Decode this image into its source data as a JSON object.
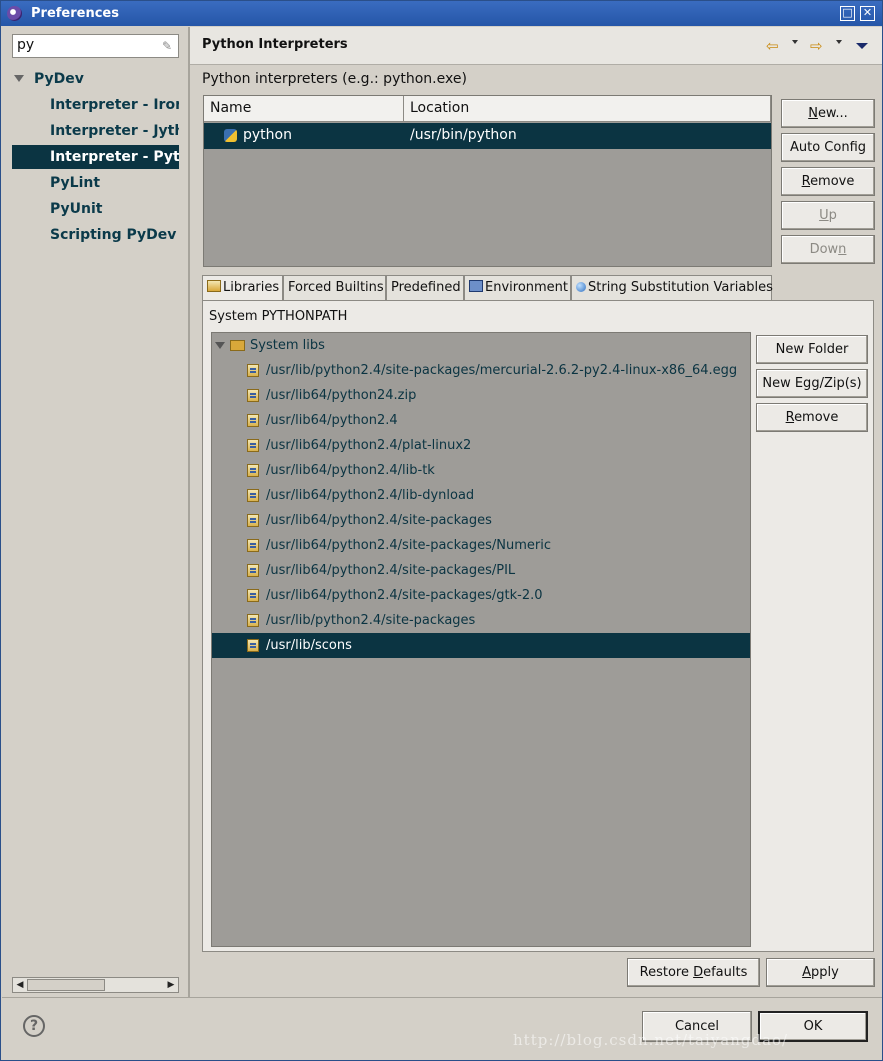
{
  "window": {
    "title": "Preferences"
  },
  "left": {
    "filter_value": "py",
    "tree": [
      {
        "label": "PyDev",
        "level": 0,
        "expanded": true,
        "selected": false
      },
      {
        "label": "Interpreter - IronPython",
        "level": 1,
        "selected": false
      },
      {
        "label": "Interpreter - Jython",
        "level": 1,
        "selected": false
      },
      {
        "label": "Interpreter - Python",
        "level": 1,
        "selected": true
      },
      {
        "label": "PyLint",
        "level": 1,
        "selected": false
      },
      {
        "label": "PyUnit",
        "level": 1,
        "selected": false
      },
      {
        "label": "Scripting PyDev",
        "level": 1,
        "selected": false
      }
    ]
  },
  "page": {
    "title": "Python Interpreters",
    "interpreters_label": "Python interpreters (e.g.: python.exe)",
    "columns": {
      "name": "Name",
      "location": "Location"
    },
    "interpreter": {
      "name": "python",
      "location": "/usr/bin/python"
    },
    "buttons": {
      "new": "New...",
      "auto_config": "Auto Config",
      "remove": "Remove",
      "up": "Up",
      "down": "Down"
    },
    "tabs": [
      "Libraries",
      "Forced Builtins",
      "Predefined",
      "Environment",
      "String Substitution Variables"
    ],
    "pythonpath_label": "System PYTHONPATH",
    "system_libs_label": "System libs",
    "libs": [
      "/usr/lib/python2.4/site-packages/mercurial-2.6.2-py2.4-linux-x86_64.egg",
      "/usr/lib64/python24.zip",
      "/usr/lib64/python2.4",
      "/usr/lib64/python2.4/plat-linux2",
      "/usr/lib64/python2.4/lib-tk",
      "/usr/lib64/python2.4/lib-dynload",
      "/usr/lib64/python2.4/site-packages",
      "/usr/lib64/python2.4/site-packages/Numeric",
      "/usr/lib64/python2.4/site-packages/PIL",
      "/usr/lib64/python2.4/site-packages/gtk-2.0",
      "/usr/lib/python2.4/site-packages",
      "/usr/lib/scons"
    ],
    "selected_lib": "/usr/lib/scons",
    "lib_buttons": {
      "new_folder": "New Folder",
      "new_egg": "New Egg/Zip(s)",
      "remove": "Remove"
    },
    "restore_defaults": "Restore Defaults",
    "apply": "Apply"
  },
  "footer": {
    "help": "?",
    "cancel": "Cancel",
    "ok": "OK"
  },
  "watermark": "http://blog.csdn.net/taiyangdao/"
}
